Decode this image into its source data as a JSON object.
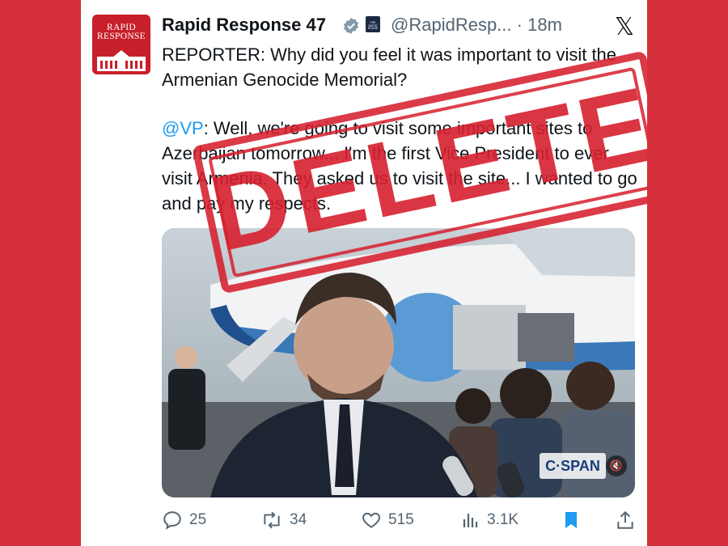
{
  "account": {
    "avatar_line1": "RAPID",
    "avatar_line2": "RESPONSE",
    "name": "Rapid Response 47",
    "handle": "@RapidResp...",
    "time": "18m",
    "affiliate_badge_text": "THE WHITE HOUSE"
  },
  "tweet": {
    "paragraph1": "REPORTER: Why did you feel it was important to visit the Armenian Genocide Memorial?",
    "mention": "@VP",
    "paragraph2_rest": ": Well, we're going to visit some important sites to Azerbaijan tomorrow... I'm the first Vice President to ever visit Armenia. They asked us to visit the site... I wanted to go and pay my respects."
  },
  "overlay": {
    "stamp_text": "DELETED",
    "stamp_color": "#d61f2d"
  },
  "media": {
    "watermark": "C·SPAN",
    "mute_icon": "speaker-muted-icon"
  },
  "actions": {
    "replies": "25",
    "reposts": "34",
    "likes": "515",
    "views": "3.1K"
  },
  "colors": {
    "background": "#d42f3a",
    "link": "#1d9bf0",
    "muted": "#536471",
    "bookmark_active": "#1d9bf0"
  }
}
